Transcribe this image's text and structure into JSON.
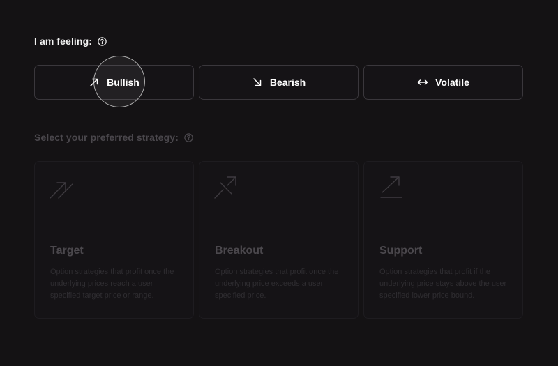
{
  "feeling": {
    "label": "I am feeling:",
    "help_icon": "question-circle-icon",
    "options": [
      {
        "label": "Bullish",
        "icon": "arrow-up-right-icon"
      },
      {
        "label": "Bearish",
        "icon": "arrow-down-right-icon"
      },
      {
        "label": "Volatile",
        "icon": "arrow-left-right-icon"
      }
    ]
  },
  "strategy": {
    "label": "Select your preferred strategy:",
    "help_icon": "question-circle-icon",
    "cards": [
      {
        "title": "Target",
        "description": "Option strategies that profit once the underlying prices reach a user specified target price or range.",
        "icon": "target-arrow-icon"
      },
      {
        "title": "Breakout",
        "description": "Option strategies that profit once the underlying price exceeds a user specified price.",
        "icon": "breakout-arrow-icon"
      },
      {
        "title": "Support",
        "description": "Option strategies that profit if the underlying price stays above the user specified lower price bound.",
        "icon": "support-arrow-icon"
      }
    ]
  },
  "colors": {
    "background": "#141214",
    "border": "#3a373c",
    "text_primary": "#ffffff",
    "text_muted": "#4a474c"
  }
}
